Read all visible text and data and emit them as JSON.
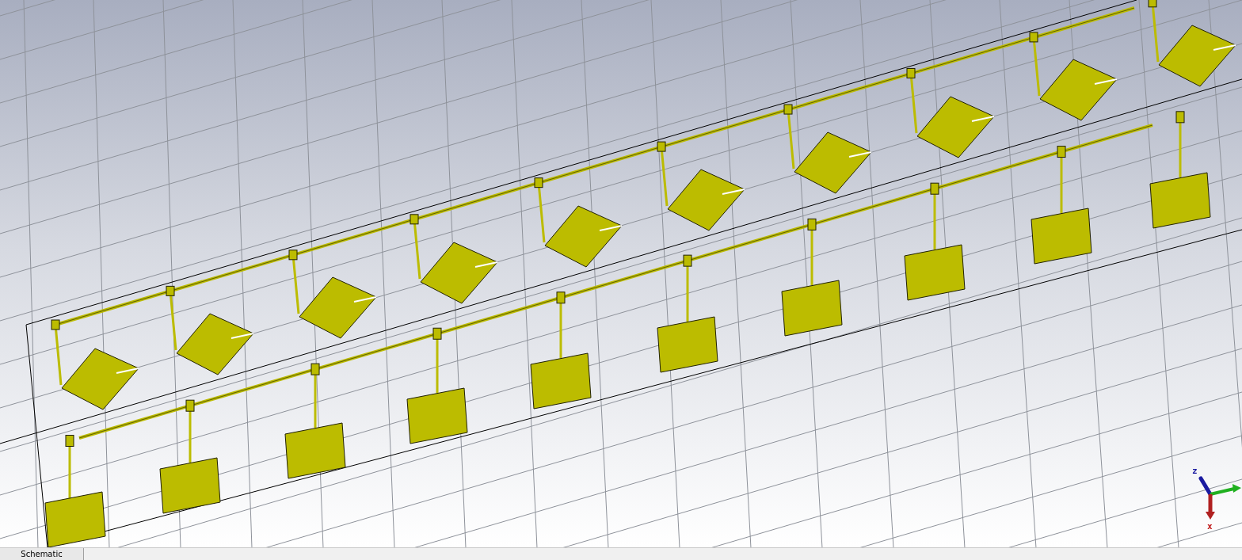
{
  "viewport": {
    "axes": [
      {
        "label": "z"
      },
      {
        "label": "x"
      }
    ]
  },
  "tabs": [
    {
      "label": "Schematic",
      "selected": true
    }
  ]
}
